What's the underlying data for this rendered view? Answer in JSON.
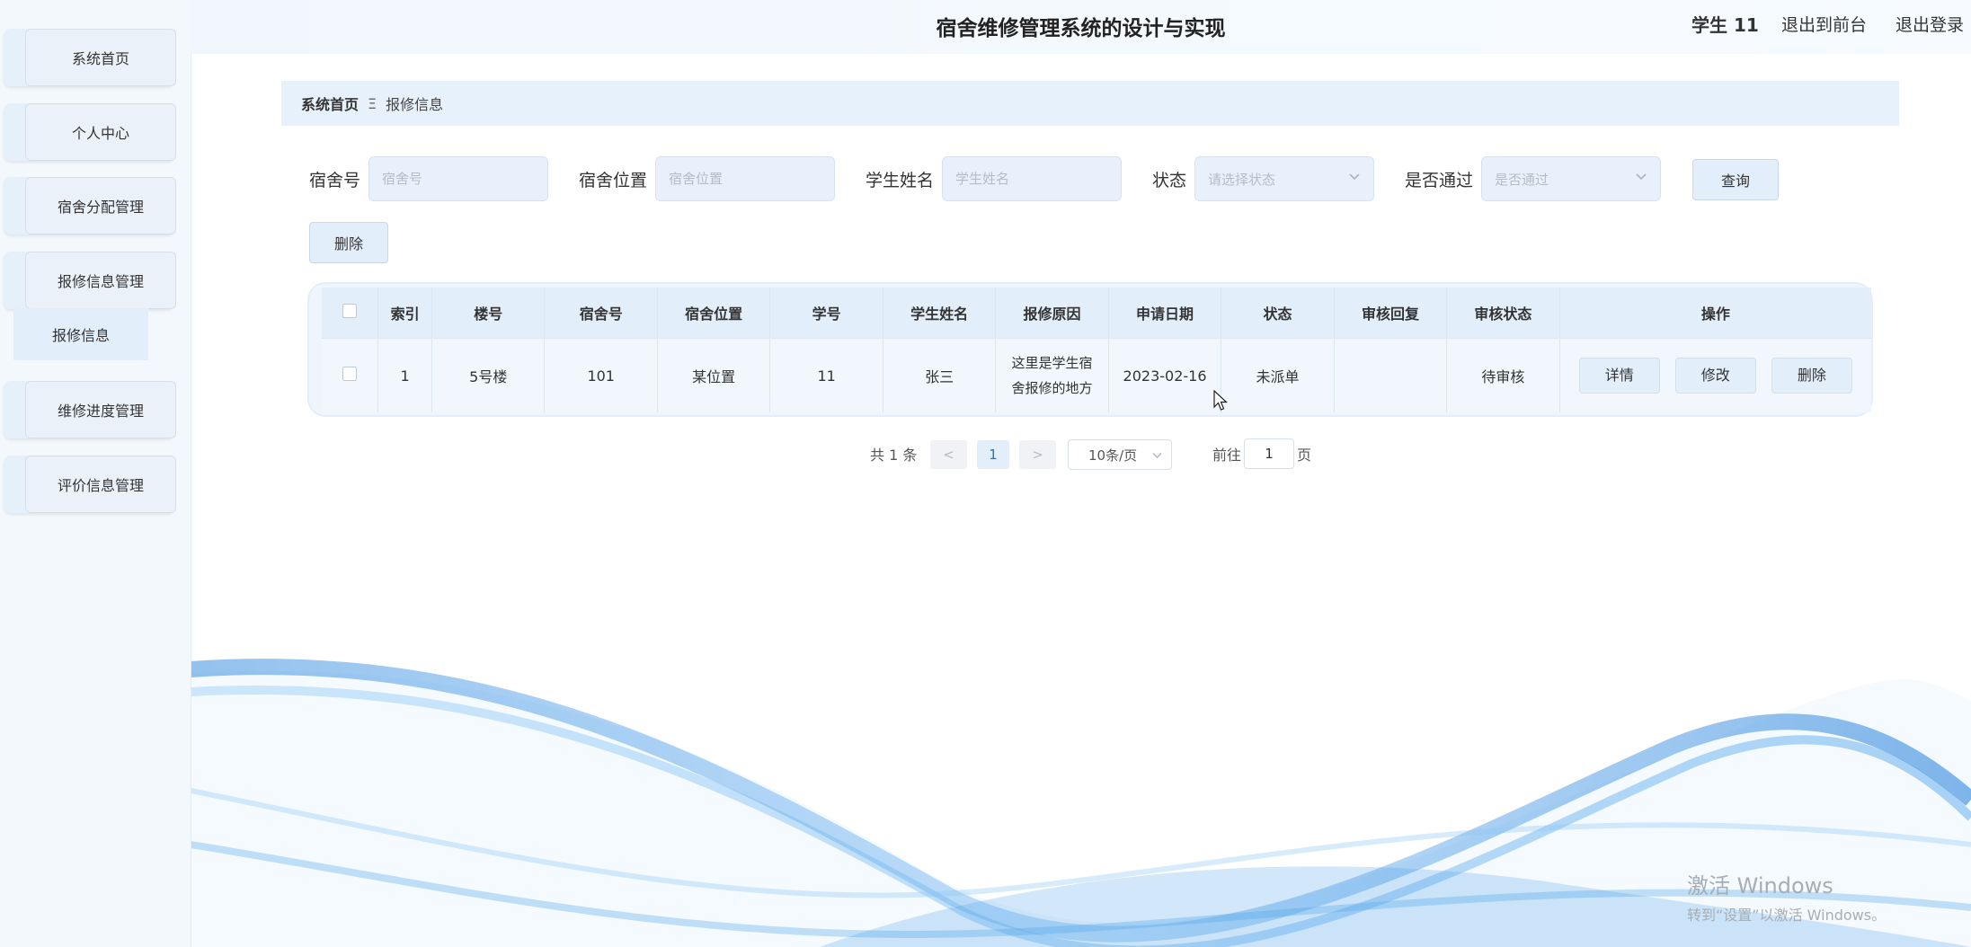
{
  "header": {
    "title": "宿舍维修管理系统的设计与实现",
    "user": "学生 11",
    "front_link": "退出到前台",
    "logout_link": "退出登录"
  },
  "sidebar": {
    "items": [
      {
        "label": "系统首页"
      },
      {
        "label": "个人中心"
      },
      {
        "label": "宿舍分配管理"
      },
      {
        "label": "报修信息管理"
      },
      {
        "label": "维修进度管理"
      },
      {
        "label": "评价信息管理"
      }
    ],
    "submenu": {
      "label": "报修信息"
    }
  },
  "breadcrumb": {
    "home": "系统首页",
    "separator": "Ξ",
    "current": "报修信息"
  },
  "search": {
    "dorm_no": {
      "label": "宿舍号",
      "placeholder": "宿舍号"
    },
    "dorm_location": {
      "label": "宿舍位置",
      "placeholder": "宿舍位置"
    },
    "student_name": {
      "label": "学生姓名",
      "placeholder": "学生姓名"
    },
    "status": {
      "label": "状态",
      "placeholder": "请选择状态"
    },
    "approved": {
      "label": "是否通过",
      "placeholder": "是否通过"
    },
    "query_button": "查询",
    "delete_button": "删除"
  },
  "table": {
    "headers": [
      "索引",
      "楼号",
      "宿舍号",
      "宿舍位置",
      "学号",
      "学生姓名",
      "报修原因",
      "申请日期",
      "状态",
      "审核回复",
      "审核状态",
      "操作"
    ],
    "rows": [
      {
        "index": "1",
        "building": "5号楼",
        "dorm_no": "101",
        "location": "某位置",
        "student_no": "11",
        "student_name": "张三",
        "reason_line1": "这里是学生宿",
        "reason_line2": "舍报修的地方",
        "apply_date": "2023-02-16",
        "status": "未派单",
        "review_reply": "",
        "review_status": "待审核",
        "actions": {
          "detail": "详情",
          "edit": "修改",
          "delete": "删除"
        }
      }
    ]
  },
  "pagination": {
    "total": "共 1 条",
    "prev": "<",
    "current_page": "1",
    "next": ">",
    "page_size": "10条/页",
    "goto_label": "前往",
    "goto_value": "1",
    "page_suffix": "页"
  },
  "watermark": {
    "line1": "激活 Windows",
    "line2": "转到“设置”以激活 Windows。"
  },
  "colors": {
    "accent": "#e3eefb",
    "sidebar_bg": "#f3f8fd",
    "wave": "#4a9de6"
  }
}
